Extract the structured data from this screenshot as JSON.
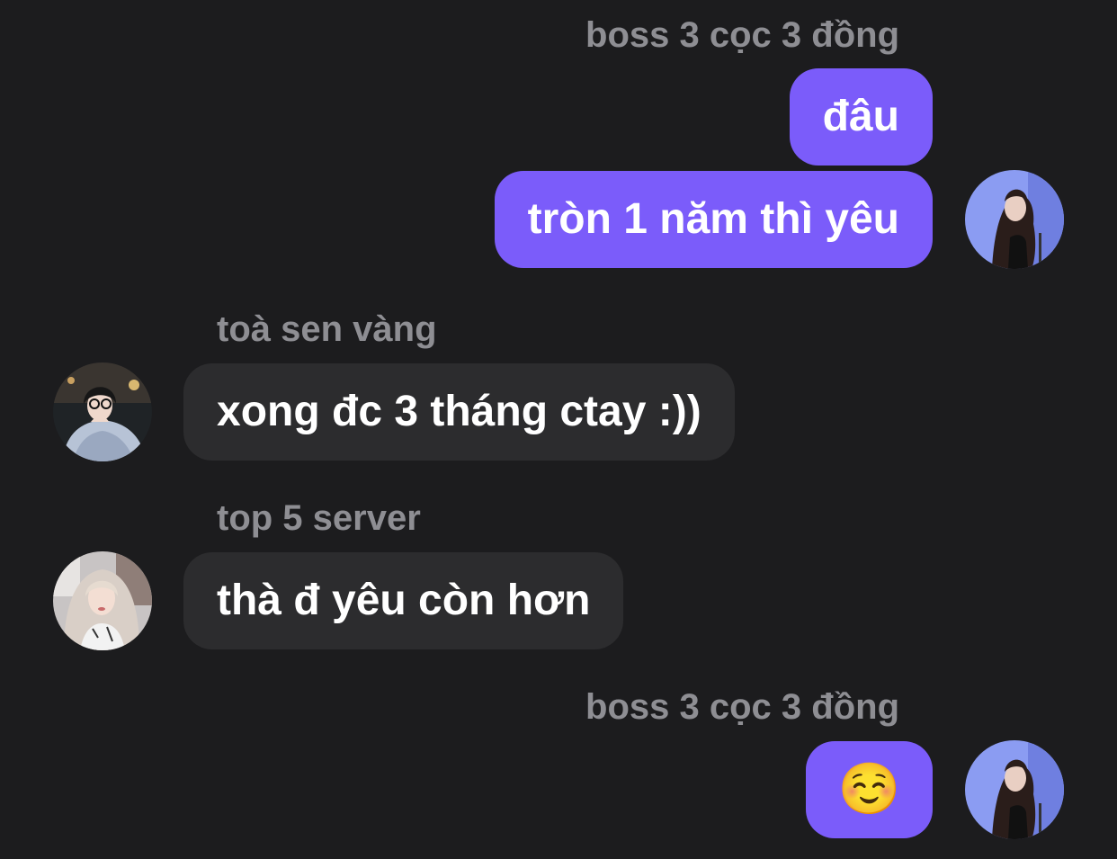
{
  "messages": {
    "group1": {
      "sender": "boss 3 cọc 3 đồng",
      "bubble1": "đâu",
      "bubble2": "tròn 1 năm thì yêu"
    },
    "group2": {
      "sender": "toà sen vàng",
      "bubble1": "xong đc 3 tháng ctay :))"
    },
    "group3": {
      "sender": "top 5 server",
      "bubble1": "thà đ yêu còn hơn"
    },
    "group4": {
      "sender": "boss 3 cọc 3 đồng",
      "bubble1": "☺️"
    }
  },
  "colors": {
    "background": "#1c1c1e",
    "outgoing_bubble": "#7b5cfa",
    "incoming_bubble": "#2c2c2e",
    "sender_name": "#8e8e93"
  },
  "icons": {
    "avatar_self": "avatar-photo",
    "avatar_toa_sen_vang": "avatar-photo",
    "avatar_top5": "avatar-photo"
  }
}
